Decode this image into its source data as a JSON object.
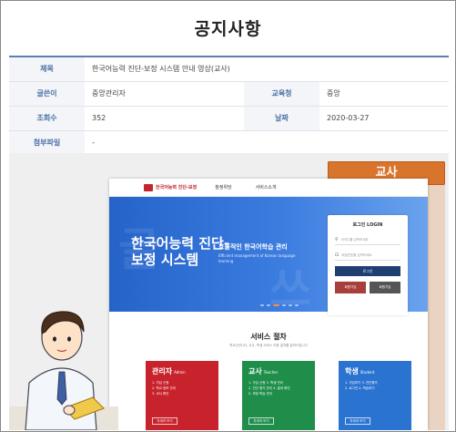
{
  "page": {
    "title": "공지사항"
  },
  "info": {
    "subject_label": "제목",
    "subject_value": "한국어능력 진단-보정 시스템 안내 영상(교사)",
    "author_label": "글쓴이",
    "author_value": "중앙관리자",
    "office_label": "교육청",
    "office_value": "중앙",
    "views_label": "조회수",
    "views_value": "352",
    "date_label": "날짜",
    "date_value": "2020-03-27",
    "attach_label": "첨부파일",
    "attach_value": "-"
  },
  "video": {
    "teacher_tab": "교사",
    "logo_text": "한국어능력 진단-보정",
    "nav_items": [
      "참정위당",
      "서비스소개"
    ],
    "hero_title": "한국어능력 진단-보정 시스템",
    "hero_sub": "효율적인 한국어학습 관리",
    "hero_sub_en": "Efficient management of Korean language learning",
    "login_title": "로그인 LOGIN",
    "login_id_placeholder": "아이디를 입력하세요",
    "login_pw_placeholder": "비밀번호를 입력하세요",
    "login_button": "로그인",
    "join_button": "회원가입",
    "find_button": "회원가입",
    "service_title": "서비스 절차",
    "service_sub": "학교(관리)자, 교사, 학생 서비스 이용 절차를 알려드립니다",
    "cards": [
      {
        "title": "관리자",
        "en": "Admin",
        "lines": [
          "1. 가입 신청",
          "2. 학교 정보 관리",
          "3. 교사 확인"
        ],
        "button": "자세히 보기"
      },
      {
        "title": "교사",
        "en": "Teacher",
        "lines": [
          "1. 가입 신청  3. 학생 관리",
          "2. 진단 평가 관리  4. 결과 확인",
          "5. 보정 학습 관리"
        ],
        "button": "자세히 보기"
      },
      {
        "title": "학생",
        "en": "Student",
        "lines": [
          "1. 가입하기  3. 진단평가",
          "2. 로그인  4. 학습하기"
        ],
        "button": "자세히 보기"
      }
    ]
  },
  "colors": {
    "accent_blue": "#2563c9",
    "table_header_text": "#4a6fa5",
    "teacher_tab": "#d9742d",
    "card_red": "#c8232c",
    "card_green": "#1f8e4a",
    "card_blue": "#2b73d1"
  }
}
